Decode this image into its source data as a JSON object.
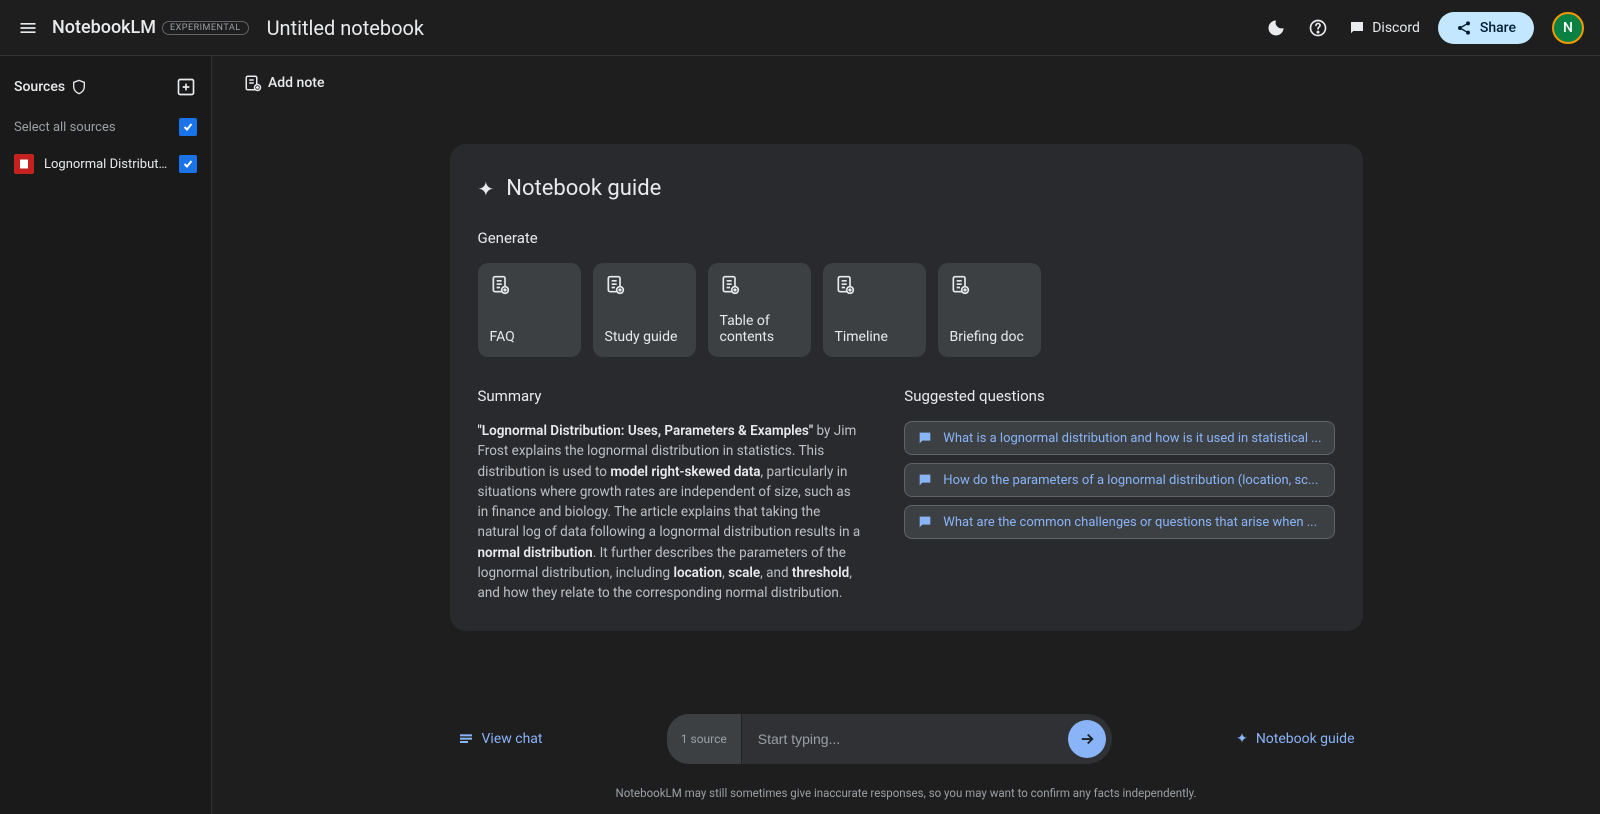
{
  "app": {
    "name": "NotebookLM",
    "badge": "EXPERIMENTAL"
  },
  "notebook": {
    "title": "Untitled notebook"
  },
  "header": {
    "discord": "Discord",
    "share": "Share",
    "avatar_letter": "N"
  },
  "sidebar": {
    "sources_label": "Sources",
    "select_all": "Select all sources",
    "items": [
      {
        "name": "Lognormal Distributio...",
        "checked": true
      }
    ]
  },
  "notes": {
    "add_note": "Add note"
  },
  "guide": {
    "title": "Notebook guide",
    "generate_label": "Generate",
    "cards": [
      {
        "label": "FAQ"
      },
      {
        "label": "Study guide"
      },
      {
        "label": "Table of contents"
      },
      {
        "label": "Timeline"
      },
      {
        "label": "Briefing doc"
      }
    ],
    "summary_title": "Summary",
    "summary": {
      "title_quote": "\"Lognormal Distribution: Uses, Parameters & Examples\"",
      "seg1": " by Jim Frost explains the lognormal distribution in statistics. This distribution is used to ",
      "bold1": "model right-skewed data",
      "seg2": ", particularly in situations where growth rates are independent of size, such as in finance and biology. The article explains that taking the natural log of data following a lognormal distribution results in a ",
      "bold2": "normal distribution",
      "seg3": ". It further describes the parameters of the lognormal distribution, including ",
      "bold3": "location",
      "comma": ", ",
      "bold4": "scale",
      "and": ", and ",
      "bold5": "threshold",
      "seg4": ", and how they relate to the corresponding normal distribution."
    },
    "suggested_title": "Suggested questions",
    "questions": [
      "What is a lognormal distribution and how is it used in statistical ...",
      "How do the parameters of a lognormal distribution (location, sc...",
      "What are the common challenges or questions that arise when ..."
    ]
  },
  "chat": {
    "view_chat": "View chat",
    "source_count": "1 source",
    "placeholder": "Start typing...",
    "nb_guide": "Notebook guide"
  },
  "disclaimer": "NotebookLM may still sometimes give inaccurate responses, so you may want to confirm any facts independently."
}
